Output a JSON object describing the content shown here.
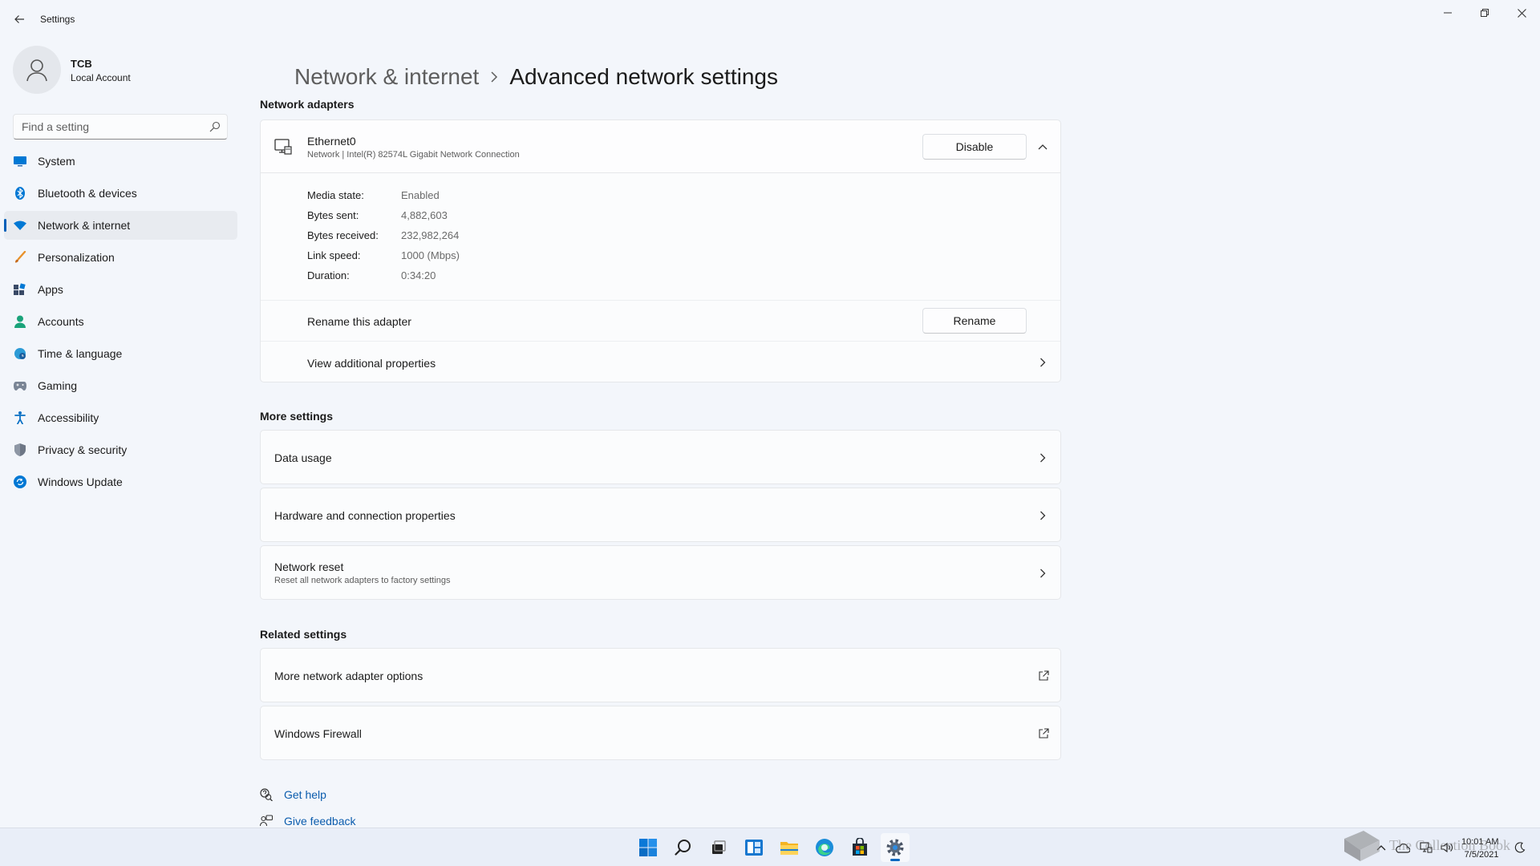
{
  "window": {
    "title": "Settings"
  },
  "profile": {
    "name": "TCB",
    "account_type": "Local Account"
  },
  "search": {
    "placeholder": "Find a setting"
  },
  "sidebar": {
    "items": [
      {
        "label": "System",
        "icon": "monitor-icon"
      },
      {
        "label": "Bluetooth & devices",
        "icon": "bluetooth-icon"
      },
      {
        "label": "Network & internet",
        "icon": "wifi-icon",
        "selected": true
      },
      {
        "label": "Personalization",
        "icon": "brush-icon"
      },
      {
        "label": "Apps",
        "icon": "apps-icon"
      },
      {
        "label": "Accounts",
        "icon": "person-icon"
      },
      {
        "label": "Time & language",
        "icon": "globe-clock-icon"
      },
      {
        "label": "Gaming",
        "icon": "gamepad-icon"
      },
      {
        "label": "Accessibility",
        "icon": "accessibility-icon"
      },
      {
        "label": "Privacy & security",
        "icon": "shield-icon"
      },
      {
        "label": "Windows Update",
        "icon": "update-icon"
      }
    ]
  },
  "breadcrumb": {
    "parent": "Network & internet",
    "current": "Advanced network settings"
  },
  "network_adapters": {
    "heading": "Network adapters",
    "adapter": {
      "name": "Ethernet0",
      "description": "Network | Intel(R) 82574L Gigabit Network Connection",
      "disable_label": "Disable",
      "expanded": true,
      "properties": [
        {
          "label": "Media state:",
          "value": "Enabled"
        },
        {
          "label": "Bytes sent:",
          "value": "4,882,603"
        },
        {
          "label": "Bytes received:",
          "value": "232,982,264"
        },
        {
          "label": "Link speed:",
          "value": "1000 (Mbps)"
        },
        {
          "label": "Duration:",
          "value": "0:34:20"
        }
      ],
      "rename_text": "Rename this adapter",
      "rename_label": "Rename",
      "view_properties": "View additional properties"
    }
  },
  "more_settings": {
    "heading": "More settings",
    "items": [
      {
        "title": "Data usage"
      },
      {
        "title": "Hardware and connection properties"
      },
      {
        "title": "Network reset",
        "subtitle": "Reset all network adapters to factory settings"
      }
    ]
  },
  "related_settings": {
    "heading": "Related settings",
    "items": [
      {
        "title": "More network adapter options"
      },
      {
        "title": "Windows Firewall"
      }
    ]
  },
  "help": {
    "get_help": "Get help",
    "give_feedback": "Give feedback"
  },
  "taskbar": {
    "apps": [
      "start-icon",
      "search-icon",
      "task-view-icon",
      "widgets-icon",
      "file-explorer-icon",
      "edge-icon",
      "store-icon",
      "settings-icon"
    ],
    "active_app": "settings-icon",
    "clock": {
      "time": "10:01 AM",
      "date": "7/5/2021"
    }
  },
  "watermark": {
    "text": "The Collection Book"
  },
  "colors": {
    "accent": "#005fb8",
    "background": "#f3f6fb",
    "card": "#fbfcfd",
    "link": "#0b5cad"
  }
}
